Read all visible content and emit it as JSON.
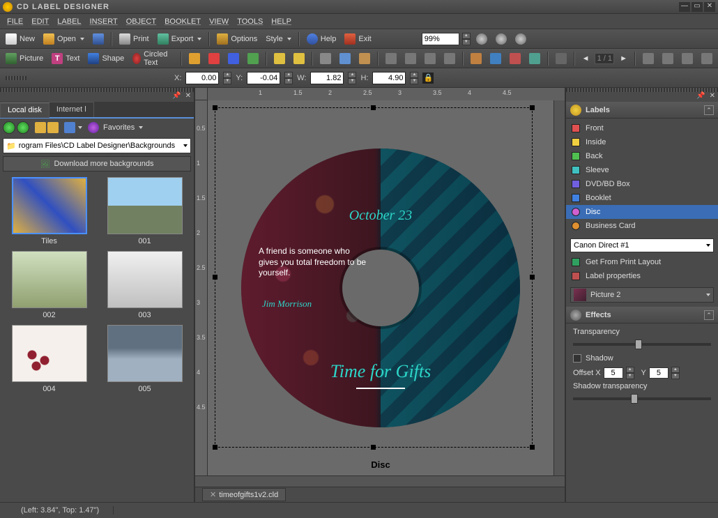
{
  "app": {
    "title": "CD LABEL DESIGNER"
  },
  "menu": [
    "FILE",
    "EDIT",
    "LABEL",
    "INSERT",
    "OBJECT",
    "BOOKLET",
    "VIEW",
    "TOOLS",
    "HELP"
  ],
  "toolbar1": {
    "new": "New",
    "open": "Open",
    "print": "Print",
    "export": "Export",
    "options": "Options",
    "style": "Style",
    "help": "Help",
    "exit": "Exit",
    "zoom": "99%",
    "page": "1 / 1"
  },
  "toolbar2": {
    "picture": "Picture",
    "text": "Text",
    "shape": "Shape",
    "circled": "Circled Text"
  },
  "props": {
    "x_label": "X:",
    "x": "0.00",
    "y_label": "Y:",
    "y": "-0.04",
    "w_label": "W:",
    "w": "1.82",
    "h_label": "H:",
    "h": "4.90"
  },
  "left": {
    "tabs": [
      "Local disk",
      "Internet l"
    ],
    "favorites": "Favorites",
    "path": "rogram Files\\CD Label Designer\\Backgrounds",
    "download": "Download more backgrounds",
    "thumbs": [
      "Tiles",
      "001",
      "002",
      "003",
      "004",
      "005"
    ]
  },
  "canvas": {
    "date": "October 23",
    "quote": "A friend is someone who gives you total freedom to be yourself.",
    "author": "Jim Morrison",
    "title": "Time for Gifts",
    "label_type": "Disc",
    "filename": "timeofgifts1v2.cld",
    "ruler_h": [
      "1",
      "1.5",
      "2",
      "2.5",
      "3",
      "3.5",
      "4",
      "4.5"
    ],
    "ruler_v": [
      "0.5",
      "1",
      "1.5",
      "2",
      "2.5",
      "3",
      "3.5",
      "4",
      "4.5"
    ]
  },
  "right": {
    "labels_title": "Labels",
    "labels": [
      {
        "name": "Front",
        "color": "#e05050"
      },
      {
        "name": "Inside",
        "color": "#f0d040"
      },
      {
        "name": "Back",
        "color": "#50c050"
      },
      {
        "name": "Sleeve",
        "color": "#40c0c0"
      },
      {
        "name": "DVD/BD Box",
        "color": "#7060e0"
      },
      {
        "name": "Booklet",
        "color": "#4080e0"
      },
      {
        "name": "Disc",
        "color": "#d060d0"
      },
      {
        "name": "Business Card",
        "color": "#e09030"
      }
    ],
    "printer": "Canon Direct #1",
    "get_layout": "Get From Print Layout",
    "label_props": "Label properties",
    "selected_obj": "Picture 2",
    "effects_title": "Effects",
    "transparency": "Transparency",
    "shadow": "Shadow",
    "offset_x_label": "Offset X",
    "offset_x": "5",
    "offset_y_label": "Y",
    "offset_y": "5",
    "shadow_trans": "Shadow transparency"
  },
  "status": {
    "coords": "(Left: 3.84\", Top: 1.47\")"
  }
}
